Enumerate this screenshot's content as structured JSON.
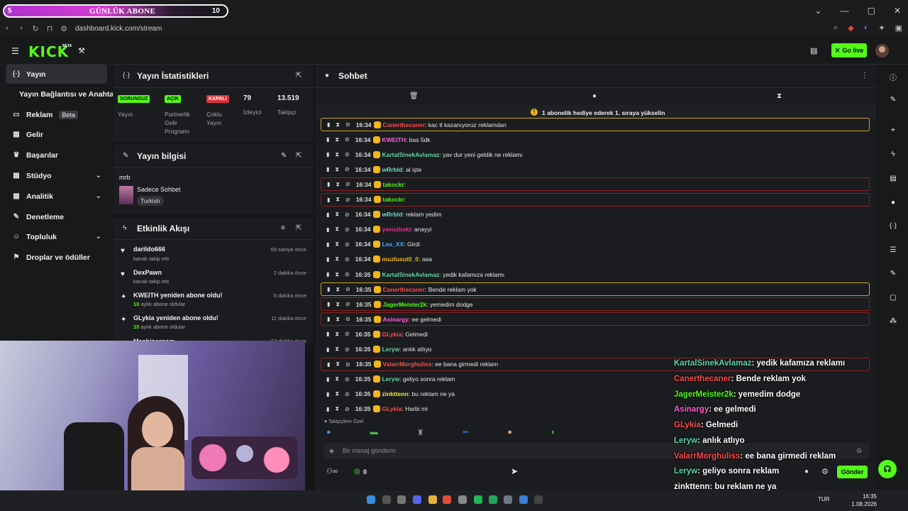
{
  "subbar": {
    "left": "5",
    "title": "GÜNLÜK ABONE",
    "count": "10"
  },
  "browser": {
    "url": "dashboard.kick.com/stream"
  },
  "kick": {
    "logo": "KICK",
    "beta": "BETA",
    "go_live": "Go live"
  },
  "nav": {
    "items": [
      {
        "label": "Yayın",
        "icon": "broadcast-icon"
      },
      {
        "label": "Yayın Bağlantısı ve Anahtarı"
      },
      {
        "label": "Reklam",
        "badge": "Beta",
        "icon": "tv-icon"
      },
      {
        "label": "Gelir",
        "icon": "chart-icon"
      },
      {
        "label": "Başarılar",
        "icon": "trophy-icon"
      },
      {
        "label": "Stüdyo",
        "icon": "grid-icon"
      },
      {
        "label": "Analitik",
        "icon": "grid-icon"
      },
      {
        "label": "Denetleme",
        "icon": "wrench-icon"
      },
      {
        "label": "Topluluk",
        "icon": "community-icon"
      },
      {
        "label": "Droplar ve ödüller",
        "icon": "gift-icon"
      }
    ]
  },
  "stats": {
    "title": "Yayın İstatistikleri",
    "items": [
      {
        "badge": "SORUNSUZ",
        "label": "Yayın"
      },
      {
        "badge": "AÇIK",
        "label": "Partnerlik Gelir Programı"
      },
      {
        "badge": "KAPALI",
        "label": "Çoklu Yayın"
      },
      {
        "value": "79",
        "label": "İzleyici"
      },
      {
        "value": "13.519",
        "label": "Takipçi"
      }
    ]
  },
  "info": {
    "title": "Yayın bilgisi",
    "stream_title": "mrb",
    "category": "Sadece Sohbet",
    "language": "Turkish"
  },
  "activity": {
    "title": "Etkinlik Akışı",
    "items": [
      {
        "title": "darildo666",
        "sub": "kanalı takip etti",
        "time": "59 saniye önce"
      },
      {
        "title": "DexPawn",
        "sub": "kanalı takip etti",
        "time": "2 dakika önce"
      },
      {
        "title": "KWEITH yeniden abone oldu!",
        "months": "10",
        "sub": "aylık abone oldular",
        "time": "5 dakika önce"
      },
      {
        "title": "GLykia yeniden abone oldu!",
        "months": "10",
        "sub": "aylık abone oldular",
        "time": "11 dakika önce"
      },
      {
        "title": "Machineroom",
        "time": "27 dakika önce"
      }
    ]
  },
  "chat": {
    "title": "Sohbet",
    "pinned": "1 abonelik hediye ederek 1. sıraya yükselin",
    "messages": [
      {
        "time": "16:34",
        "user": "Canerthecaner",
        "color": "#ff4a4a",
        "text": "kac tl kazanıyoruz reklamdan",
        "hl": "gold"
      },
      {
        "time": "16:34",
        "user": "KWEITH",
        "color": "#ff5fd7",
        "text": "bas 5dk",
        "hl": ""
      },
      {
        "time": "16:34",
        "user": "KartalSinekAvlamaz",
        "color": "#5fd6a6",
        "text": "yav dur yeni geldik ne reklamı",
        "hl": ""
      },
      {
        "time": "16:34",
        "user": "wRrbld",
        "color": "#6fd6c4",
        "text": "al işte",
        "hl": ""
      },
      {
        "time": "16:34",
        "user": "takockr",
        "color": "#53fc18",
        "text": "",
        "hl": "red"
      },
      {
        "time": "16:34",
        "user": "takockr",
        "color": "#53fc18",
        "text": "",
        "hl": "red"
      },
      {
        "time": "16:34",
        "user": "wRrbld",
        "color": "#6fd6c4",
        "text": "reklam yedim",
        "hl": ""
      },
      {
        "time": "16:34",
        "user": "yavuzbaki",
        "color": "#e0348c",
        "text": "anayyi",
        "hl": ""
      },
      {
        "time": "16:34",
        "user": "Lea_XX",
        "color": "#4aa3ff",
        "text": "Girdi",
        "hl": ""
      },
      {
        "time": "16:34",
        "user": "muzlusut0_0",
        "color": "#f2b51c",
        "text": "aaa",
        "hl": ""
      },
      {
        "time": "16:35",
        "user": "KartalSinekAvlamaz",
        "color": "#5fd6a6",
        "text": "yedik kafamıza reklamı",
        "hl": ""
      },
      {
        "time": "16:35",
        "user": "Canerthecaner",
        "color": "#ff4a4a",
        "text": "Bende reklam yok",
        "hl": "gold"
      },
      {
        "time": "16:35",
        "user": "JagerMeister2k",
        "color": "#53fc18",
        "text": "yemedim dodge",
        "hl": "red"
      },
      {
        "time": "16:35",
        "user": "Asinargy",
        "color": "#ff5fd7",
        "text": "ee gelmedi",
        "hl": "red"
      },
      {
        "time": "16:35",
        "user": "GLykia",
        "color": "#ff4a4a",
        "text": "Gelmedi",
        "hl": ""
      },
      {
        "time": "16:35",
        "user": "Leryw",
        "color": "#5fd6a6",
        "text": "anlık atlıyo",
        "hl": ""
      },
      {
        "time": "16:35",
        "user": "ValarrMorghuliss",
        "color": "#ff4a4a",
        "text": "ee bana girmedi reklam",
        "hl": "red"
      },
      {
        "time": "16:35",
        "user": "Leryw",
        "color": "#5fd6a6",
        "text": "geliyo sonra reklam",
        "hl": ""
      },
      {
        "time": "16:35",
        "user": "zinkttenn",
        "color": "#f2e44a",
        "text": "bu reklam ne ya",
        "hl": ""
      },
      {
        "time": "16:35",
        "user": "GLykia",
        "color": "#ff4a4a",
        "text": "Harbi mi",
        "hl": ""
      }
    ],
    "follower_label": "Takipçilere Özel",
    "input_placeholder": "Bir mesaj gönderin",
    "points": "0",
    "send": "Gönder"
  },
  "overlay": [
    {
      "user": "KartalSinekAvlamaz",
      "text": ": yedik kafamıza reklamı",
      "color": "#5fd6a6"
    },
    {
      "user": "Canerthecaner",
      "text": ": Bende reklam yok",
      "color": "#ff4a4a"
    },
    {
      "user": "JagerMeister2k",
      "text": ": yemedim dodge",
      "color": "#53fc18"
    },
    {
      "user": "Asinargy",
      "text": ": ee gelmedi",
      "color": "#ff5fd7"
    },
    {
      "user": "GLykia",
      "text": ": Gelmedi",
      "color": "#ff4a4a"
    },
    {
      "user": "Leryw",
      "text": ": anlık atlıyo",
      "color": "#5fd6a6"
    },
    {
      "user": "ValarrMorghuliss",
      "text": ": ee bana girmedi reklam",
      "color": "#ff4a4a"
    },
    {
      "user": "Leryw",
      "text": ": geliyo sonra reklam",
      "color": "#5fd6a6"
    },
    {
      "user": "zinkttenn",
      "text": ": bu reklam ne ya",
      "color": "#ffffff"
    },
    {
      "user": "GLykia",
      "text": ": Harbi mi",
      "color": "#ff4a4a"
    }
  ],
  "taskbar": {
    "lang": "TUR",
    "time": "16:35",
    "date": "1.08.2026"
  }
}
